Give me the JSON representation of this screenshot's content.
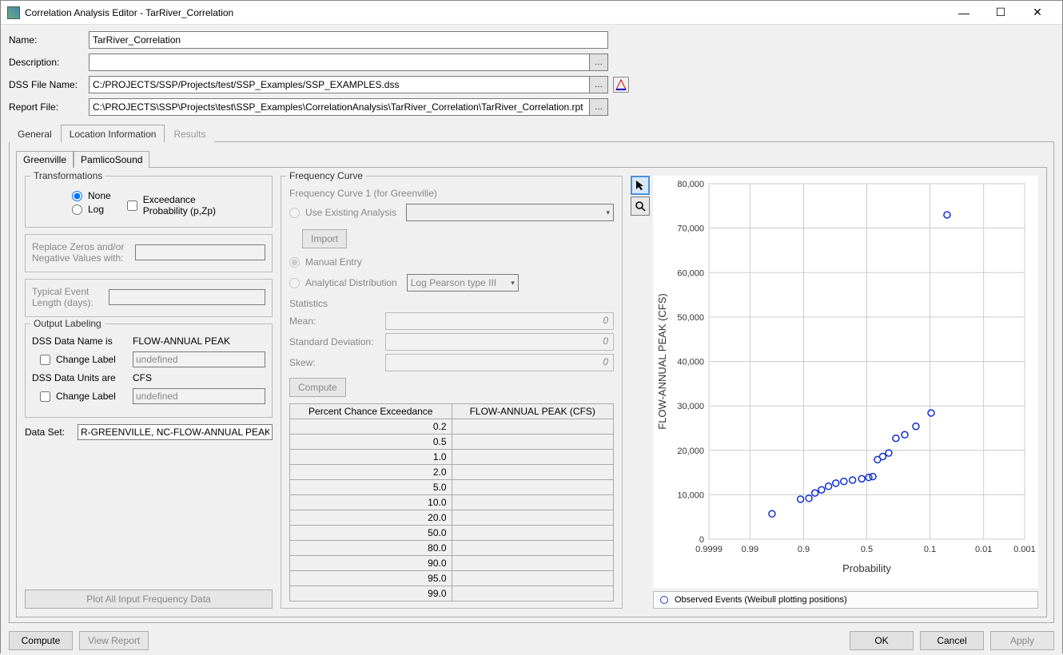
{
  "window": {
    "title": "Correlation Analysis Editor - TarRiver_Correlation"
  },
  "form": {
    "name_label": "Name:",
    "name_value": "TarRiver_Correlation",
    "desc_label": "Description:",
    "desc_value": "",
    "dss_label": "DSS File Name:",
    "dss_value": "C:/PROJECTS/SSP/Projects/test/SSP_Examples/SSP_EXAMPLES.dss",
    "report_label": "Report File:",
    "report_value": "C:\\PROJECTS\\SSP\\Projects\\test\\SSP_Examples\\CorrelationAnalysis\\TarRiver_Correlation\\TarRiver_Correlation.rpt"
  },
  "tabs": {
    "general": "General",
    "location": "Location Information",
    "results": "Results"
  },
  "subtabs": {
    "greenville": "Greenville",
    "pamlico": "PamlicoSound"
  },
  "transformations": {
    "legend": "Transformations",
    "none": "None",
    "log": "Log",
    "exceed": "Exceedance Probability (p,Zp)"
  },
  "replace": {
    "label": "Replace Zeros and/or Negative Values with:"
  },
  "typical": {
    "label": "Typical Event Length (days):"
  },
  "labeling": {
    "legend": "Output Labeling",
    "dss_name_is": "DSS Data Name is",
    "flow_peak": "FLOW-ANNUAL PEAK",
    "change_label": "Change Label",
    "undefined": "undefined",
    "dss_units_are": "DSS Data Units are",
    "cfs": "CFS"
  },
  "dataset": {
    "label": "Data Set:",
    "value": "R-GREENVILLE, NC-FLOW-ANNUAL PEAK"
  },
  "plot_all_btn": "Plot All Input Frequency Data",
  "freq": {
    "legend": "Frequency Curve",
    "subtitle": "Frequency Curve 1 (for Greenville)",
    "use_existing": "Use Existing Analysis",
    "import": "Import",
    "manual": "Manual Entry",
    "analytical": "Analytical Distribution",
    "dist_selected": "Log Pearson type III",
    "stats": "Statistics",
    "mean": "Mean:",
    "sd": "Standard Deviation:",
    "skew": "Skew:",
    "zero": "0",
    "compute": "Compute",
    "th1": "Percent Chance Exceedance",
    "th2": "FLOW-ANNUAL PEAK (CFS)",
    "rows": [
      "0.2",
      "0.5",
      "1.0",
      "2.0",
      "5.0",
      "10.0",
      "20.0",
      "50.0",
      "80.0",
      "90.0",
      "95.0",
      "99.0"
    ]
  },
  "footer": {
    "compute": "Compute",
    "view_report": "View Report",
    "ok": "OK",
    "cancel": "Cancel",
    "apply": "Apply"
  },
  "chart_data": {
    "type": "scatter",
    "title": "",
    "xlabel": "Probability",
    "ylabel": "FLOW-ANNUAL PEAK (CFS)",
    "x_ticks_labels": [
      "0.9999",
      "0.99",
      "0.9",
      "0.5",
      "0.1",
      "0.01",
      "0.001"
    ],
    "y_ticks": [
      0,
      10000,
      20000,
      30000,
      40000,
      50000,
      60000,
      70000,
      80000
    ],
    "y_tick_labels": [
      "0",
      "10,000",
      "20,000",
      "30,000",
      "40,000",
      "50,000",
      "60,000",
      "70,000",
      "80,000"
    ],
    "legend": "Observed Events (Weibull plotting positions)",
    "series": [
      {
        "name": "Observed Events",
        "points": [
          {
            "p": 0.952,
            "y": 5700
          },
          {
            "p": 0.905,
            "y": 9000
          },
          {
            "p": 0.857,
            "y": 9200
          },
          {
            "p": 0.81,
            "y": 10400
          },
          {
            "p": 0.762,
            "y": 11100
          },
          {
            "p": 0.714,
            "y": 11900
          },
          {
            "p": 0.667,
            "y": 12600
          },
          {
            "p": 0.619,
            "y": 13000
          },
          {
            "p": 0.571,
            "y": 13300
          },
          {
            "p": 0.524,
            "y": 13600
          },
          {
            "p": 0.476,
            "y": 13900
          },
          {
            "p": 0.429,
            "y": 14100
          },
          {
            "p": 0.381,
            "y": 17900
          },
          {
            "p": 0.333,
            "y": 18600
          },
          {
            "p": 0.286,
            "y": 19400
          },
          {
            "p": 0.238,
            "y": 22700
          },
          {
            "p": 0.19,
            "y": 23500
          },
          {
            "p": 0.143,
            "y": 25400
          },
          {
            "p": 0.095,
            "y": 28400
          },
          {
            "p": 0.048,
            "y": 73000
          }
        ]
      }
    ]
  }
}
